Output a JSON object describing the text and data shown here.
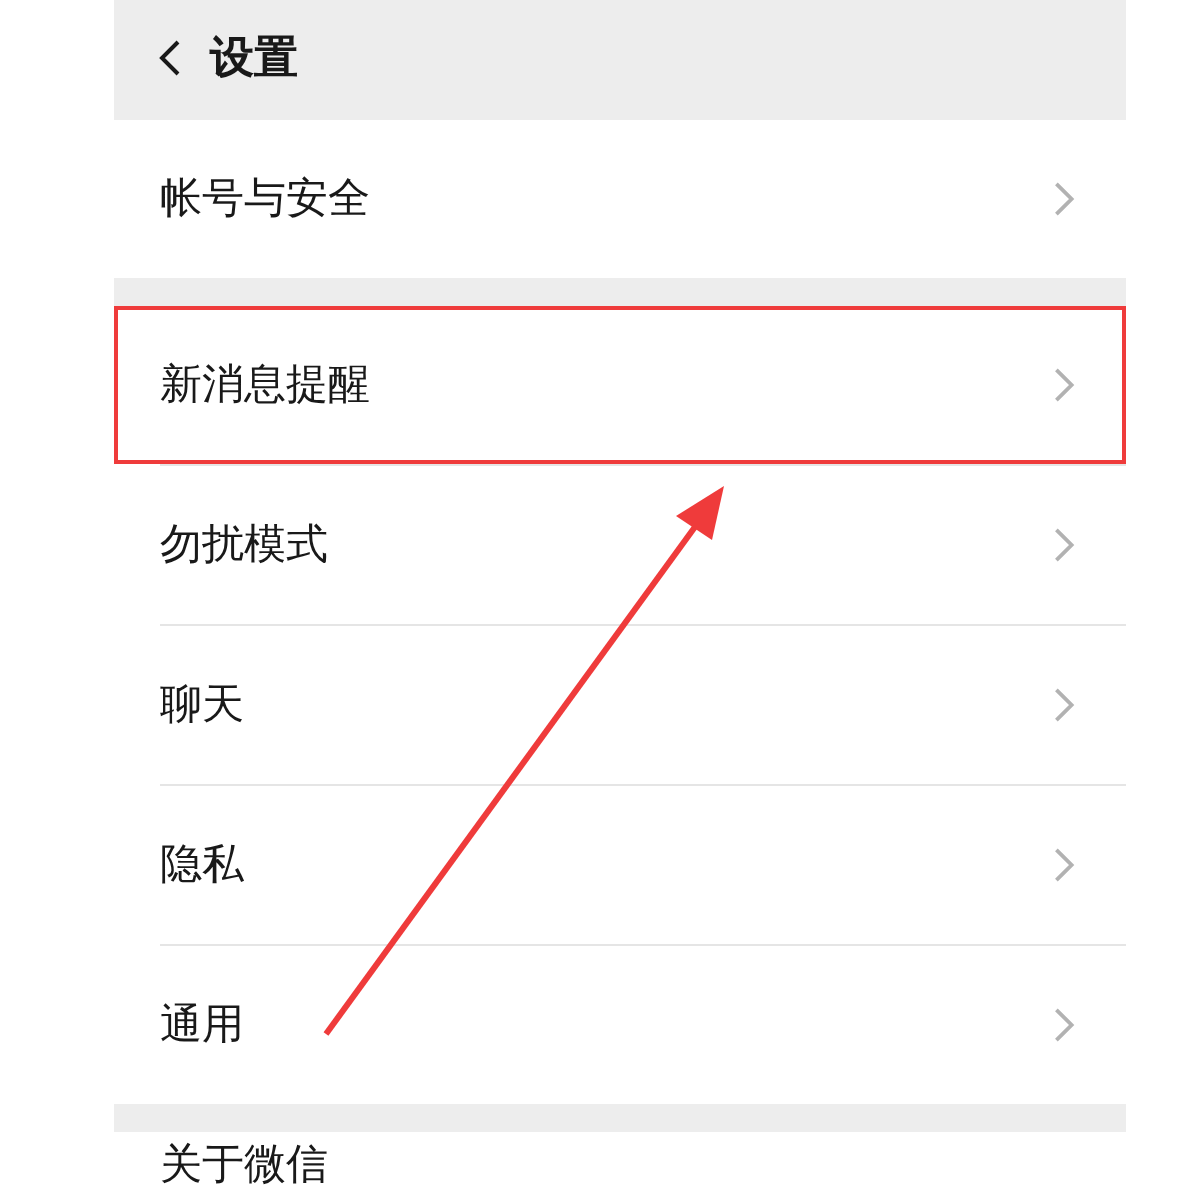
{
  "header": {
    "title": "设置"
  },
  "groups": [
    {
      "items": [
        {
          "label": "帐号与安全",
          "highlighted": false
        }
      ]
    },
    {
      "items": [
        {
          "label": "新消息提醒",
          "highlighted": true
        },
        {
          "label": "勿扰模式",
          "highlighted": false
        },
        {
          "label": "聊天",
          "highlighted": false
        },
        {
          "label": "隐私",
          "highlighted": false
        },
        {
          "label": "通用",
          "highlighted": false
        }
      ]
    },
    {
      "items": [
        {
          "label": "关于微信",
          "highlighted": false
        }
      ]
    }
  ],
  "annotation": {
    "kind": "arrow"
  }
}
